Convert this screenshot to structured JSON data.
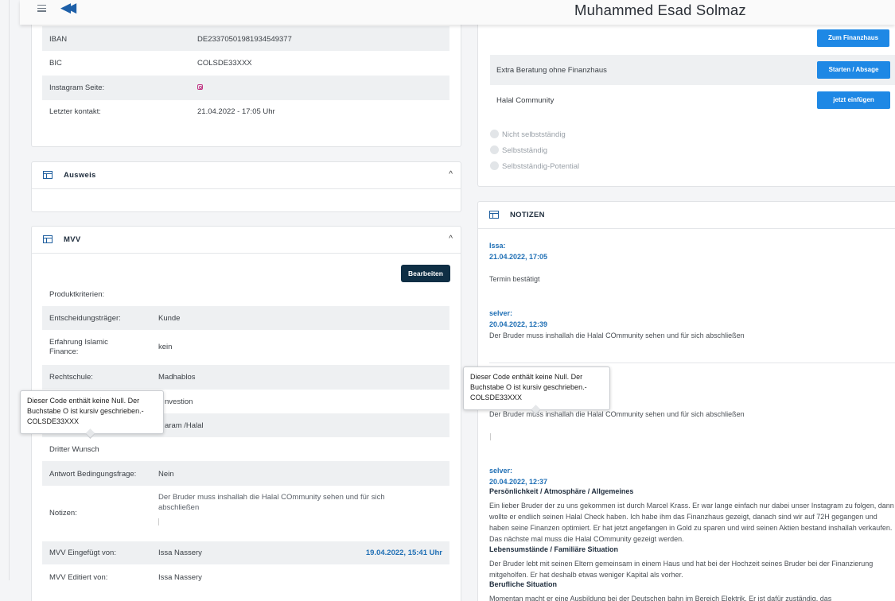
{
  "header": {
    "user_name": "Muhammed Esad Solmaz"
  },
  "bank_card": {
    "rows": [
      {
        "label": "IBAN",
        "value": "DE23370501981934549377"
      },
      {
        "label": "BIC",
        "value": "COLSDE33XXX"
      },
      {
        "label": "Instagram Seite:",
        "value": ""
      },
      {
        "label": "Letzter kontakt:",
        "value": "21.04.2022 - 17:05 Uhr"
      }
    ]
  },
  "ausweis_card": {
    "title": "Ausweis"
  },
  "mvv_card": {
    "title": "MVV",
    "edit_button": "Bearbeiten",
    "rows": [
      {
        "label": "Produktkriterien:",
        "value": ""
      },
      {
        "label": "Entscheidungsträger:",
        "value": "Kunde"
      },
      {
        "label": "Erfahrung Islamic Finance:",
        "value": "kein"
      },
      {
        "label": "Rechtschule:",
        "value": "Madhablos"
      },
      {
        "label": "",
        "value": "nvestion"
      },
      {
        "label": "",
        "value": "aram /Halal"
      },
      {
        "label": "Dritter Wunsch",
        "value": ""
      },
      {
        "label": "Antwort Bedingungsfrage:",
        "value": "Nein"
      },
      {
        "label": "Notizen:",
        "value": "Der Bruder muss inshallah die Halal COmmunity sehen und für sich abschließen"
      },
      {
        "label": "MVV Eingefügt von:",
        "value": "Issa Nassery",
        "date": "19.04.2022, 15:41 Uhr"
      },
      {
        "label": "MVV Editiert von:",
        "value": "Issa Nassery"
      }
    ]
  },
  "actions_card": {
    "rows": [
      {
        "label": "",
        "button": "Zum Finanzhaus"
      },
      {
        "label": "Extra Beratung ohne Finanzhaus",
        "button": "Starten / Absage"
      },
      {
        "label": "Halal Community",
        "button": "jetzt einfügen"
      }
    ],
    "radios": [
      "Nicht selbstständig",
      "Selbstständig",
      "Selbstständig-Potential"
    ]
  },
  "notes_card": {
    "title": "NOTIZEN",
    "notes": [
      {
        "author": "Issa:",
        "date": "21.04.2022, 17:05",
        "text": "Termin bestätigt"
      },
      {
        "author": "selver:",
        "date": "20.04.2022, 12:39",
        "text": "Der Bruder muss inshallah die Halal COmmunity sehen und für sich abschließen"
      },
      {
        "text": "Der Bruder muss inshallah die Halal COmmunity sehen und für sich abschließen"
      },
      {
        "author": "selver:",
        "date": "20.04.2022, 12:37",
        "h1": "Persönlichkeit / Atmosphäre / Allgemeines",
        "p1": "Ein lieber Bruder der zu uns gekommen ist durch Marcel Krass. Er war lange einfach nur dabei unser Instagram zu folgen, dann wollte er endlich seinen Halal Check haben. Ich habe ihm das Finanzhaus gezeigt, danach sind wir auf 72H gegangen und haben seine Finanzen optimiert. Er hat jetzt angefangen in Gold zu sparen und wird seinen Aktien bestand inshallah verkaufen. Das nächste mal muss die Halal COmmunity gezeigt werden.",
        "h2": "Lebensumstände / Familiäre Situation",
        "p2": "Der Bruder lebt mit seinen Eltern gemeinsam in einem Haus und hat bei der Hochzeit seines Bruder bei der Finanzierung mitgeholfen. Er hat deshalb etwas weniger Kapital als vorher.",
        "h3": "Berufliche Situation",
        "p3": "Momentan macht er eine Ausbildung bei der Deutschen bahn im Bereich Elektrik. Er ist dafür zuständig, das"
      }
    ]
  },
  "tooltips": {
    "bic_tooltip": "Dieser Code enthält keine Null. Der Buchstabe O ist kursiv geschrieben.-COLSDE33XXX"
  }
}
